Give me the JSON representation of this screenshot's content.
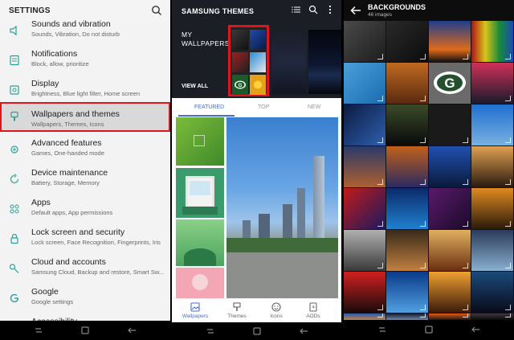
{
  "settings": {
    "title": "SETTINGS",
    "items": [
      {
        "title": "Sounds and vibration",
        "sub": "Sounds, Vibration, Do not disturb",
        "icon": "speaker-icon"
      },
      {
        "title": "Notifications",
        "sub": "Block, allow, prioritize",
        "icon": "notification-icon"
      },
      {
        "title": "Display",
        "sub": "Brightness, Blue light filter, Home screen",
        "icon": "display-icon"
      },
      {
        "title": "Wallpapers and themes",
        "sub": "Wallpapers, Themes, Icons",
        "icon": "brush-icon"
      },
      {
        "title": "Advanced features",
        "sub": "Games, One-handed mode",
        "icon": "gear-plus-icon"
      },
      {
        "title": "Device maintenance",
        "sub": "Battery, Storage, Memory",
        "icon": "refresh-icon"
      },
      {
        "title": "Apps",
        "sub": "Default apps, App permissions",
        "icon": "apps-grid-icon"
      },
      {
        "title": "Lock screen and security",
        "sub": "Lock screen, Face Recognition, Fingerprints, Iris",
        "icon": "lock-icon"
      },
      {
        "title": "Cloud and accounts",
        "sub": "Samsung Cloud, Backup and restore, Smart Sw...",
        "icon": "key-icon"
      },
      {
        "title": "Google",
        "sub": "Google settings",
        "icon": "google-icon"
      },
      {
        "title": "Accessibility",
        "sub": "",
        "icon": "accessibility-icon"
      }
    ]
  },
  "themes": {
    "title": "SAMSUNG THEMES",
    "my_wallpapers_line1": "MY",
    "my_wallpapers_line2": "WALLPAPERS",
    "view_all": "VIEW ALL",
    "tabs": [
      "FEATURED",
      "TOP",
      "NEW"
    ],
    "bottom_nav": [
      "Wallpapers",
      "Themes",
      "Icons",
      "AODs"
    ]
  },
  "backgrounds": {
    "title": "BACKGROUNDS",
    "count": "46 images"
  },
  "colors": {
    "accent_teal": "#2aa198",
    "highlight_red": "#e0141e",
    "active_blue": "#4d6bd6"
  }
}
